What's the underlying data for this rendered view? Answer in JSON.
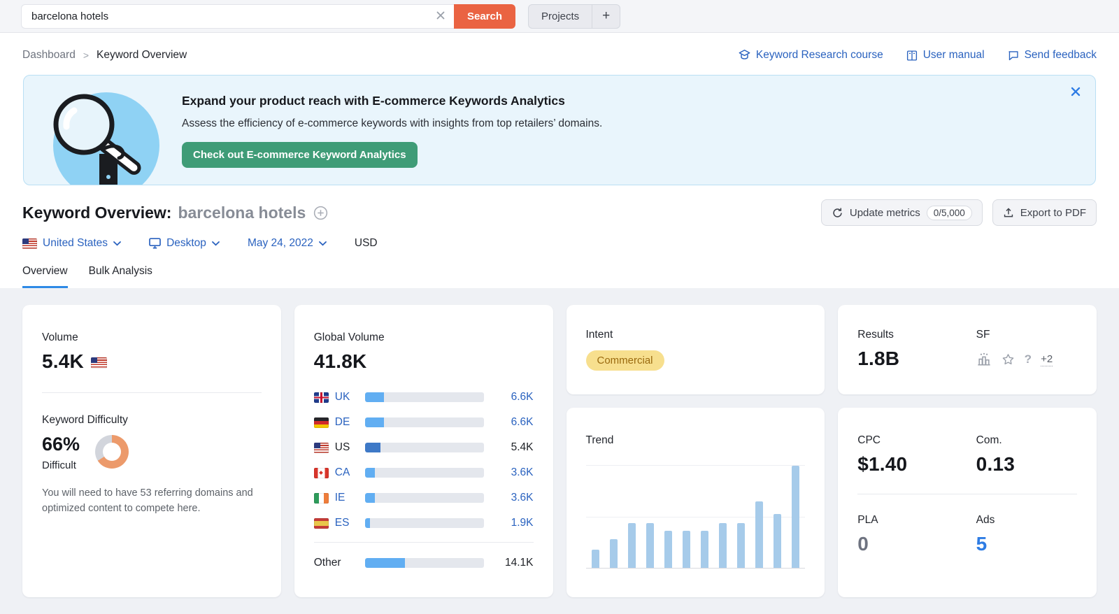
{
  "colors": {
    "accent_blue": "#2A62BF",
    "bright_blue": "#2E7CE4",
    "search_orange": "#EA6342",
    "cta_green": "#3F9C77",
    "donut_orange": "#EC9A6B",
    "donut_track": "#D2D5DC",
    "bar_fill": "#61AEF2",
    "bar_fill_highlight": "#3E79C7",
    "trend_bar": "#A6CBEA",
    "intent_bg": "#F7DF8E",
    "intent_text": "#9A6A0F"
  },
  "topbar": {
    "search_value": "barcelona hotels",
    "search_button": "Search",
    "projects_button": "Projects",
    "add_button": "+"
  },
  "breadcrumb": {
    "items": [
      "Dashboard",
      "Keyword Overview"
    ],
    "separator": ">"
  },
  "header_links": [
    {
      "icon": "academy-cap-icon",
      "label": "Keyword Research course"
    },
    {
      "icon": "book-icon",
      "label": "User manual"
    },
    {
      "icon": "feedback-bubble-icon",
      "label": "Send feedback"
    }
  ],
  "banner": {
    "title": "Expand your product reach with E-commerce Keywords Analytics",
    "subtitle": "Assess the efficiency of e-commerce keywords with insights from top retailers’ domains.",
    "cta_label": "Check out E-commerce Keyword Analytics",
    "illustration": "magnifier-illustration"
  },
  "page_header": {
    "title": "Keyword Overview:",
    "keyword": "barcelona hotels",
    "update_metrics_label": "Update metrics",
    "update_metrics_quota": "0/5,000",
    "export_pdf_label": "Export to PDF"
  },
  "filters": {
    "country": "United States",
    "device": "Desktop",
    "date": "May 24, 2022",
    "currency": "USD"
  },
  "tabs": [
    {
      "label": "Overview",
      "active": true
    },
    {
      "label": "Bulk Analysis",
      "active": false
    }
  ],
  "cards": {
    "volume": {
      "label": "Volume",
      "value": "5.4K",
      "flag": "flag-us"
    },
    "difficulty": {
      "label": "Keyword Difficulty",
      "percent_value": 66,
      "percent_label": "66%",
      "level": "Difficult",
      "note": "You will need to have 53 referring domains and optimized content to compete here."
    },
    "global_volume": {
      "label": "Global Volume",
      "value": "41.8K",
      "rows": [
        {
          "flag": "flag-uk",
          "code": "UK",
          "value": "6.6K",
          "fraction": 0.158,
          "highlight": false
        },
        {
          "flag": "flag-de",
          "code": "DE",
          "value": "6.6K",
          "fraction": 0.158,
          "highlight": false
        },
        {
          "flag": "flag-us",
          "code": "US",
          "value": "5.4K",
          "fraction": 0.129,
          "highlight": true
        },
        {
          "flag": "flag-ca",
          "code": "CA",
          "value": "3.6K",
          "fraction": 0.086,
          "highlight": false
        },
        {
          "flag": "flag-ie",
          "code": "IE",
          "value": "3.6K",
          "fraction": 0.086,
          "highlight": false
        },
        {
          "flag": "flag-es",
          "code": "ES",
          "value": "1.9K",
          "fraction": 0.045,
          "highlight": false
        }
      ],
      "other": {
        "label": "Other",
        "value": "14.1K",
        "fraction": 0.337
      }
    },
    "intent": {
      "label": "Intent",
      "badge": "Commercial"
    },
    "results": {
      "label": "Results",
      "value": "1.8B"
    },
    "serp_features": {
      "label": "SF",
      "icons": [
        "local-pack-icon",
        "star-icon",
        "question-icon"
      ],
      "question_glyph": "?",
      "more_label": "+2"
    },
    "trend": {
      "label": "Trend"
    },
    "cpc": {
      "label": "CPC",
      "value": "$1.40"
    },
    "competition": {
      "label": "Com.",
      "value": "0.13"
    },
    "pla": {
      "label": "PLA",
      "value": "0"
    },
    "ads": {
      "label": "Ads",
      "value": "5"
    }
  },
  "chart_data": {
    "type": "bar",
    "title": "Trend",
    "categories": [
      "m1",
      "m2",
      "m3",
      "m4",
      "m5",
      "m6",
      "m7",
      "m8",
      "m9",
      "m10",
      "m11",
      "m12"
    ],
    "values": [
      0.18,
      0.28,
      0.44,
      0.44,
      0.36,
      0.36,
      0.36,
      0.44,
      0.44,
      0.65,
      0.53,
      1.0
    ],
    "xlabel": "",
    "ylabel": "",
    "ylim": [
      0,
      1
    ],
    "grid": "two horizontal gridlines + baseline, axes unlabeled",
    "legend": "none",
    "notes": "12 monthly bars of relative search volume (normalized to tallest bar)"
  }
}
